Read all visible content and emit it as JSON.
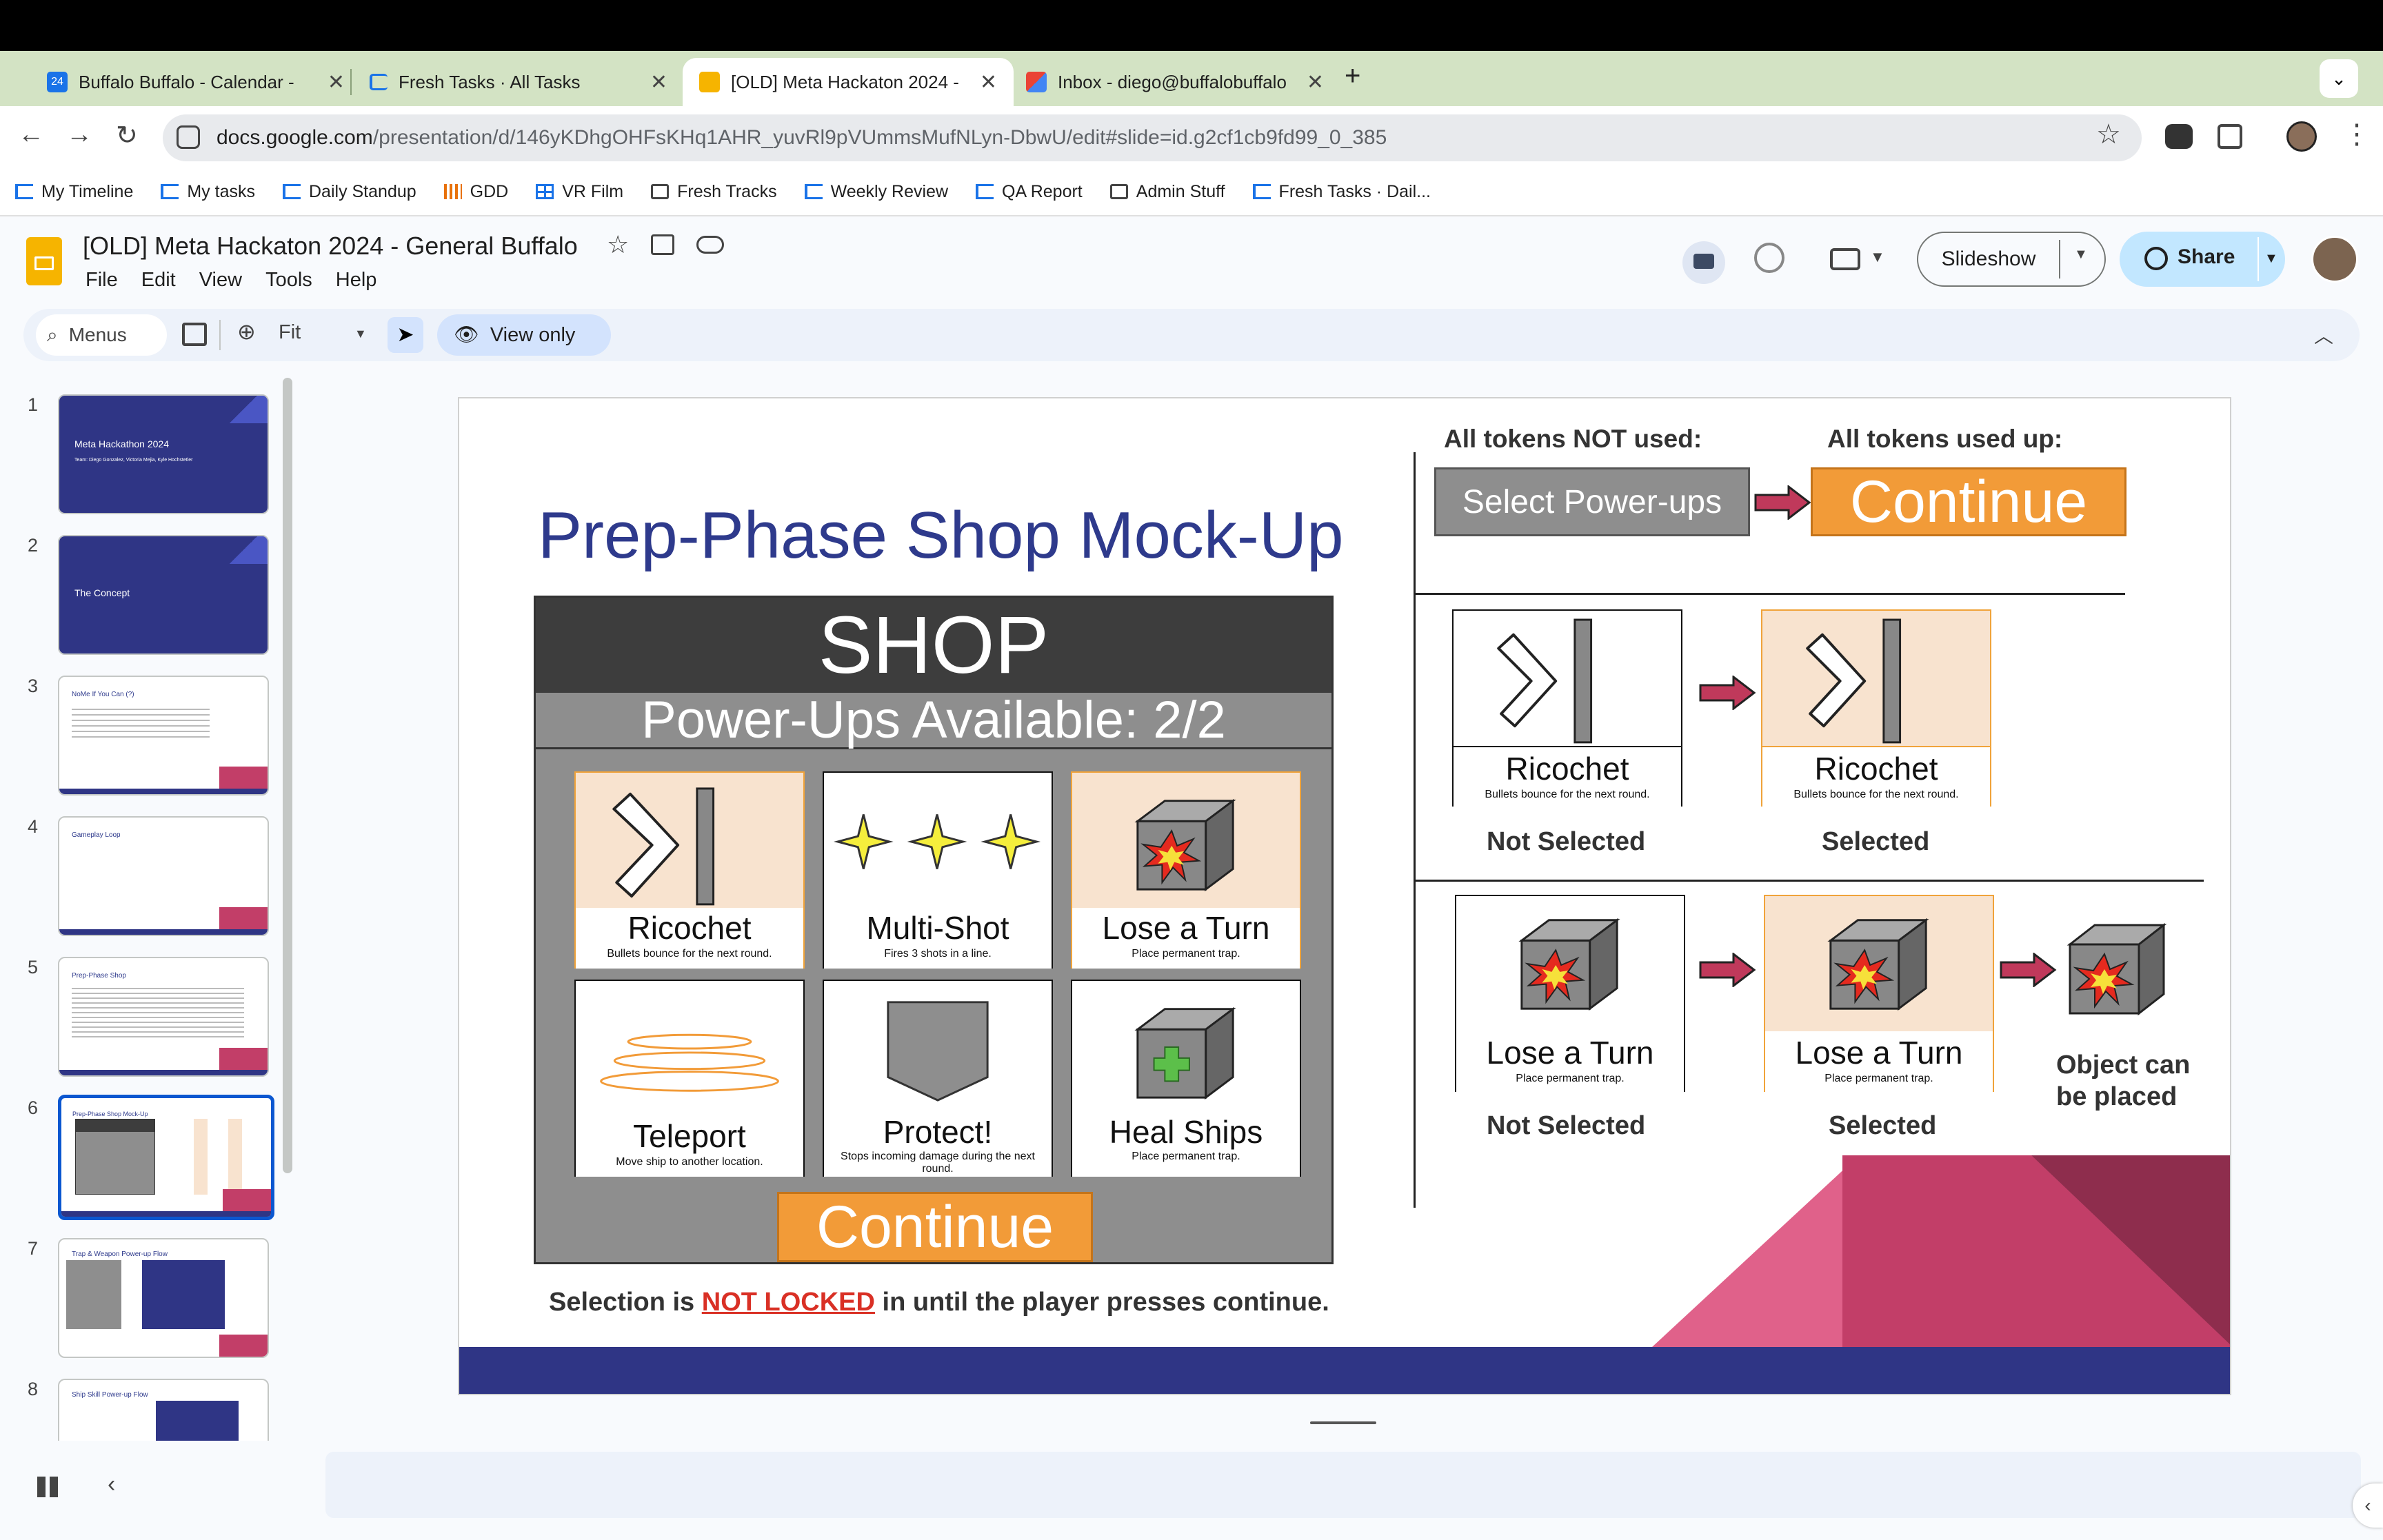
{
  "browser": {
    "tabs": [
      {
        "title": "Buffalo Buffalo - Calendar - ",
        "favicon_text": "24",
        "active": false
      },
      {
        "title": "Fresh Tasks · All Tasks",
        "active": false
      },
      {
        "title": "[OLD] Meta Hackaton 2024 -",
        "active": true
      },
      {
        "title": "Inbox - diego@buffalobuffalo",
        "active": false
      }
    ],
    "url_host": "docs.google.com",
    "url_path": "/presentation/d/146yKDhgOHFsKHq1AHR_yuvRl9pVUmmsMufNLyn-DbwU/edit#slide=id.g2cf1cb9fd99_0_385",
    "bookmarks": [
      {
        "label": "My Timeline",
        "icon": "task-icon"
      },
      {
        "label": "My tasks",
        "icon": "task-icon"
      },
      {
        "label": "Daily Standup",
        "icon": "task-icon"
      },
      {
        "label": "GDD",
        "icon": "bars-icon"
      },
      {
        "label": "VR Film",
        "icon": "grid-icon"
      },
      {
        "label": "Fresh Tracks",
        "icon": "folder-icon"
      },
      {
        "label": "Weekly Review",
        "icon": "task-icon"
      },
      {
        "label": "QA Report",
        "icon": "task-icon"
      },
      {
        "label": "Admin Stuff",
        "icon": "folder-icon"
      },
      {
        "label": "Fresh Tasks · Dail...",
        "icon": "task-icon"
      }
    ]
  },
  "app": {
    "doc_title": "[OLD] Meta Hackaton 2024 - General Buffalo",
    "menus": [
      "File",
      "Edit",
      "View",
      "Tools",
      "Help"
    ],
    "slideshow_label": "Slideshow",
    "share_label": "Share",
    "toolbar": {
      "menus_search": "Menus",
      "zoom": "Fit",
      "view_only": "View only"
    }
  },
  "filmstrip": [
    {
      "num": "1",
      "title": "Meta Hackathon 2024",
      "subtitle": "Team: Diego Gonzalez, Victoria Mejia, Kyle Hochstetler",
      "style": "dark"
    },
    {
      "num": "2",
      "title": "The Concept",
      "style": "dark"
    },
    {
      "num": "3",
      "title": "NoMe If You Can (?)",
      "style": "light"
    },
    {
      "num": "4",
      "title": "Gameplay Loop",
      "style": "light"
    },
    {
      "num": "5",
      "title": "Prep-Phase Shop",
      "style": "light"
    },
    {
      "num": "6",
      "title": "Prep-Phase Shop Mock-Up",
      "style": "light",
      "selected": true
    },
    {
      "num": "7",
      "title": "Trap & Weapon Power-up Flow",
      "style": "light"
    },
    {
      "num": "8",
      "title": "Ship Skill Power-up Flow",
      "style": "light"
    }
  ],
  "slide": {
    "title": "Prep-Phase Shop Mock-Up",
    "shop_header": "SHOP",
    "powerups_available": "Power-Ups Available: 2/2",
    "cards": [
      {
        "name": "Ricochet",
        "desc": "Bullets bounce for the next round.",
        "icon": "ricochet-icon",
        "highlighted": true
      },
      {
        "name": "Multi-Shot",
        "desc": "Fires 3 shots in a line.",
        "icon": "stars-icon",
        "highlighted": false
      },
      {
        "name": "Lose a Turn",
        "desc": "Place permanent trap.",
        "icon": "explosion-cube-icon",
        "highlighted": true
      },
      {
        "name": "Teleport",
        "desc": "Move ship to another location.",
        "icon": "teleport-rings-icon",
        "highlighted": false
      },
      {
        "name": "Protect!",
        "desc": "Stops incoming damage during the next round.",
        "icon": "shield-icon",
        "highlighted": false
      },
      {
        "name": "Heal Ships",
        "desc": "Place permanent trap.",
        "icon": "heal-cube-icon",
        "highlighted": false
      }
    ],
    "continue_label": "Continue",
    "footer_pre": "Selection is ",
    "footer_locked": "NOT LOCKED",
    "footer_post": " in until the player presses continue.",
    "tokens_not_used": "All tokens NOT used:",
    "tokens_used_up": "All tokens used up:",
    "select_powerups": "Select Power-ups",
    "ricochet_name": "Ricochet",
    "ricochet_desc": "Bullets bounce for the next round.",
    "lose_name": "Lose a Turn",
    "lose_desc": "Place permanent trap.",
    "not_selected": "Not Selected",
    "selected": "Selected",
    "object_placed_1": "Object can",
    "object_placed_2": "be placed"
  },
  "colors": {
    "slide_title": "#2e3a8c",
    "shop_dark": "#3d3d3d",
    "shop_gray": "#8e8e8e",
    "orange": "#f29b38",
    "peach": "#f8e3cf",
    "arrow": "#c0395b",
    "navy": "#2f3585",
    "pink1": "#e0618a",
    "pink2": "#c23e68",
    "pink3": "#8e2d4d",
    "locked_red": "#d93025"
  }
}
